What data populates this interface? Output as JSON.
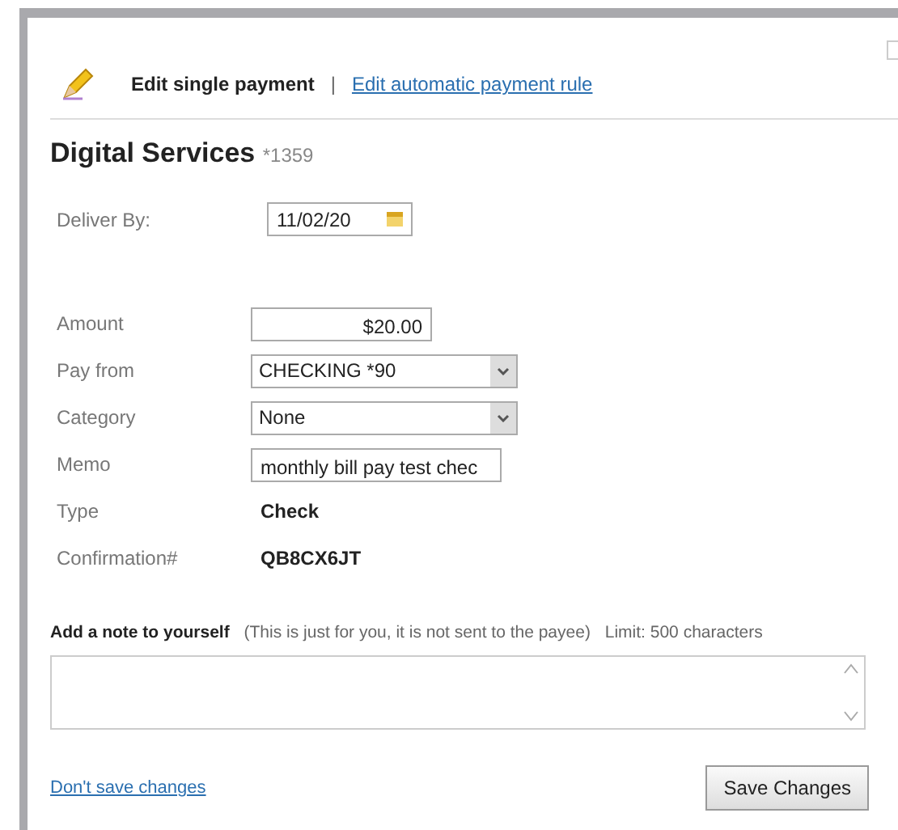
{
  "header": {
    "active_tab": "Edit single payment",
    "separator": "|",
    "link": "Edit automatic payment rule"
  },
  "payee": {
    "name": "Digital Services",
    "account": "*1359"
  },
  "deliver_by": {
    "label": "Deliver By:",
    "value": "11/02/20"
  },
  "fields": [
    {
      "kind": "text",
      "label": "Amount",
      "value": "$20.00"
    },
    {
      "kind": "select",
      "label": "Pay from",
      "value": "CHECKING *90"
    },
    {
      "kind": "select",
      "label": "Category",
      "value": "None"
    },
    {
      "kind": "memo",
      "label": "Memo",
      "value": "monthly bill pay test chec"
    },
    {
      "kind": "static",
      "label": "Type",
      "value": "Check"
    },
    {
      "kind": "static",
      "label": "Confirmation#",
      "value": "QB8CX6JT"
    }
  ],
  "note": {
    "label": "Add a note to yourself",
    "hint": "(This is just for you, it is not sent to the payee)",
    "limit": "Limit: 500 characters"
  },
  "footer": {
    "cancel_link": "Don't save changes",
    "save_button": "Save Changes"
  }
}
